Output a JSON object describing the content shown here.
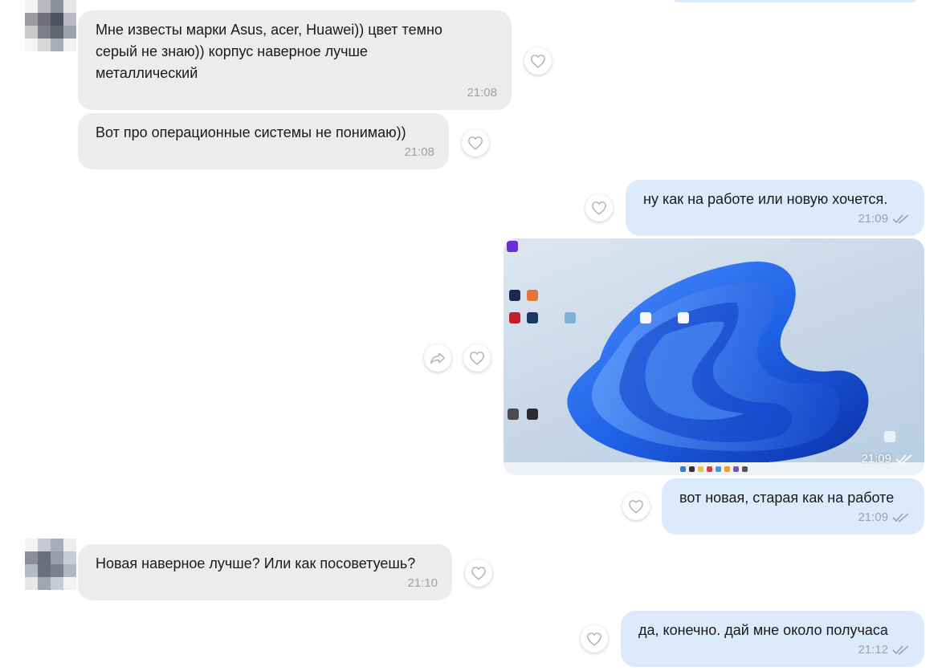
{
  "colors": {
    "incoming_bubble": "#ececec",
    "outgoing_bubble": "#dcebfb",
    "timestamp": "#9aa3ab",
    "bloom": "#1f63e6"
  },
  "icons": {
    "like": "heart-outline-icon",
    "share": "share-arrow-icon",
    "read": "double-check-icon"
  },
  "messages": [
    {
      "direction": "in",
      "text": "Мне известы марки Asus, acer, Huawei)) цвет темно\nсерый не знаю)) корпус наверное лучше\nметаллический",
      "time": "21:08"
    },
    {
      "direction": "in",
      "text": "Вот про операционные системы не понимаю))",
      "time": "21:08"
    },
    {
      "direction": "out",
      "text": "ну как на работе или новую хочется.",
      "time": "21:09"
    },
    {
      "direction": "out",
      "type": "image",
      "time": "21:09"
    },
    {
      "direction": "out",
      "text": "вот новая, старая как на работе",
      "time": "21:09"
    },
    {
      "direction": "in",
      "text": "Новая наверное лучше? Или как посоветуешь?",
      "time": "21:10"
    },
    {
      "direction": "out",
      "text": "да, конечно. дай мне около получаса",
      "time": "21:12"
    }
  ]
}
